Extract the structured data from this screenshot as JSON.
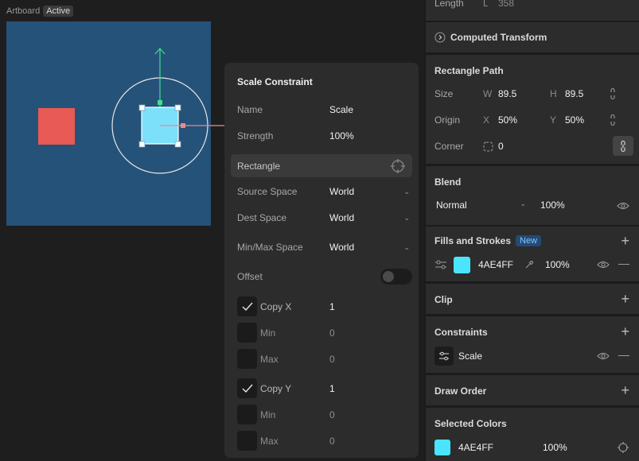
{
  "artboard": {
    "label": "Artboard",
    "status": "Active"
  },
  "popup": {
    "title": "Scale Constraint",
    "name_label": "Name",
    "name_value": "Scale",
    "strength_label": "Strength",
    "strength_value": "100%",
    "target": "Rectangle",
    "source_space_label": "Source Space",
    "source_space_value": "World",
    "dest_space_label": "Dest Space",
    "dest_space_value": "World",
    "minmax_space_label": "Min/Max Space",
    "minmax_space_value": "World",
    "offset_label": "Offset",
    "copy_x": {
      "label": "Copy X",
      "value": "1",
      "min_label": "Min",
      "min_value": "0",
      "max_label": "Max",
      "max_value": "0"
    },
    "copy_y": {
      "label": "Copy Y",
      "value": "1",
      "min_label": "Min",
      "min_value": "0",
      "max_label": "Max",
      "max_value": "0"
    }
  },
  "inspector": {
    "length": {
      "label": "Length",
      "axis": "L",
      "value": "358"
    },
    "computed_transform": "Computed Transform",
    "rectangle_path": {
      "title": "Rectangle Path",
      "size_label": "Size",
      "w_label": "W",
      "w_value": "89.5",
      "h_label": "H",
      "h_value": "89.5",
      "origin_label": "Origin",
      "x_label": "X",
      "x_value": "50%",
      "y_label": "Y",
      "y_value": "50%",
      "corner_label": "Corner",
      "corner_value": "0"
    },
    "blend": {
      "title": "Blend",
      "mode": "Normal",
      "opacity": "100%"
    },
    "fills": {
      "title": "Fills and Strokes",
      "badge": "New",
      "hex": "4AE4FF",
      "opacity": "100%",
      "color": "#4ae4ff"
    },
    "clip": {
      "title": "Clip"
    },
    "constraints": {
      "title": "Constraints",
      "item": "Scale"
    },
    "draw_order": {
      "title": "Draw Order"
    },
    "selected_colors": {
      "title": "Selected Colors",
      "hex": "4AE4FF",
      "opacity": "100%",
      "color": "#4ae4ff"
    }
  }
}
